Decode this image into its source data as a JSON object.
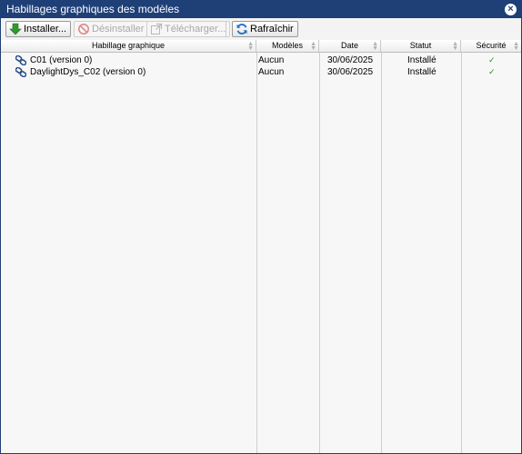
{
  "window": {
    "title": "Habillages graphiques des modèles",
    "close_glyph": "×"
  },
  "toolbar": {
    "install": "Installer...",
    "uninstall": "Désinstaller",
    "download": "Télécharger...",
    "refresh": "Rafraîchir"
  },
  "table": {
    "columns": [
      "Habillage graphique",
      "Modèles",
      "Date",
      "Statut",
      "Sécurité"
    ],
    "rows": [
      {
        "name": "C01 (version 0)",
        "models": "Aucun",
        "date": "30/06/2025",
        "status": "Installé",
        "security": "✓"
      },
      {
        "name": "DaylightDys_C02 (version 0)",
        "models": "Aucun",
        "date": "30/06/2025",
        "status": "Installé",
        "security": "✓"
      }
    ]
  },
  "colors": {
    "titlebar": "#1f3f77",
    "install_arrow": "#2f9a2f",
    "refresh_icon": "#1f6fbf",
    "check": "#2a8a2a",
    "row_icon": "#2b4f8a"
  },
  "icons": {
    "install": "green-down-arrow-icon",
    "uninstall": "no-entry-icon",
    "download": "external-link-icon",
    "refresh": "refresh-icon",
    "row": "theme-link-icon",
    "close": "close-icon"
  }
}
